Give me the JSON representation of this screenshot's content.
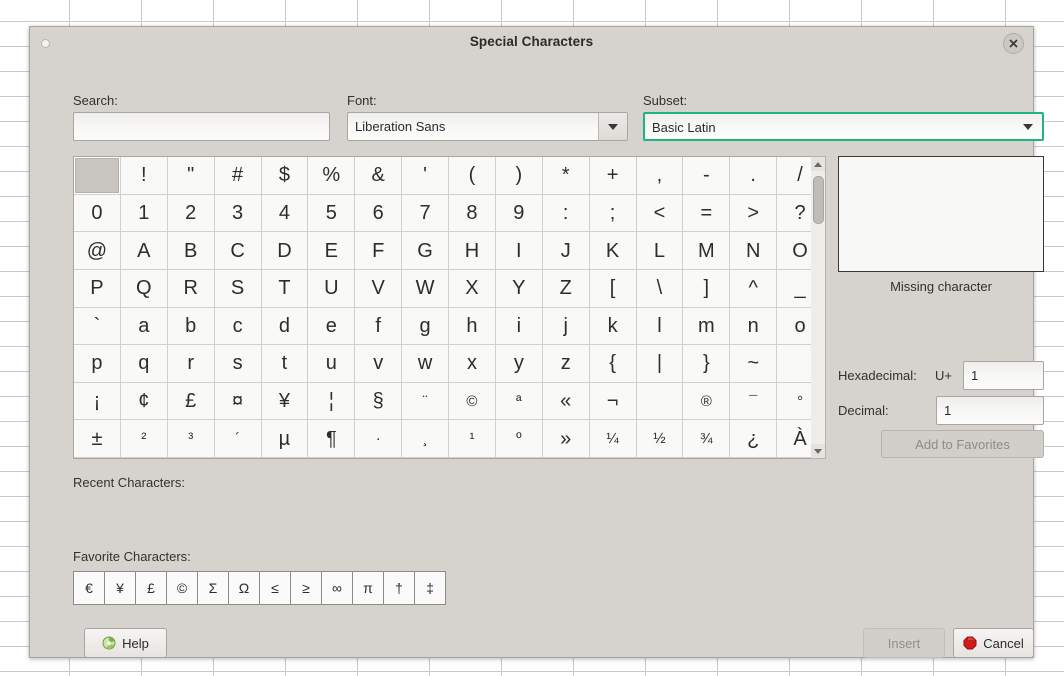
{
  "dialog": {
    "title": "Special Characters",
    "close_icon": "close-icon"
  },
  "form": {
    "search_label": "Search:",
    "search_value": "",
    "search_placeholder": "",
    "font_label": "Font:",
    "font_value": "Liberation Sans",
    "subset_label": "Subset:",
    "subset_value": "Basic Latin",
    "subset_focus_color": "#21b47c"
  },
  "grid": {
    "selected_index": 0,
    "rows": [
      [
        " ",
        "!",
        "\"",
        "#",
        "$",
        "%",
        "&",
        "'",
        "(",
        ")",
        "*",
        "+",
        ",",
        "-",
        ".",
        "/"
      ],
      [
        "0",
        "1",
        "2",
        "3",
        "4",
        "5",
        "6",
        "7",
        "8",
        "9",
        ":",
        ";",
        "<",
        "=",
        ">",
        "?"
      ],
      [
        "@",
        "A",
        "B",
        "C",
        "D",
        "E",
        "F",
        "G",
        "H",
        "I",
        "J",
        "K",
        "L",
        "M",
        "N",
        "O"
      ],
      [
        "P",
        "Q",
        "R",
        "S",
        "T",
        "U",
        "V",
        "W",
        "X",
        "Y",
        "Z",
        "[",
        "\\",
        "]",
        "^",
        "_"
      ],
      [
        "`",
        "a",
        "b",
        "c",
        "d",
        "e",
        "f",
        "g",
        "h",
        "i",
        "j",
        "k",
        "l",
        "m",
        "n",
        "o"
      ],
      [
        "p",
        "q",
        "r",
        "s",
        "t",
        "u",
        "v",
        "w",
        "x",
        "y",
        "z",
        "{",
        "|",
        "}",
        "~",
        ""
      ],
      [
        "¡",
        "¢",
        "£",
        "¤",
        "¥",
        "¦",
        "§",
        "¨",
        "©",
        "ª",
        "«",
        "¬",
        "",
        "®",
        "¯",
        "°"
      ],
      [
        "±",
        "²",
        "³",
        "´",
        "µ",
        "¶",
        "·",
        "¸",
        "¹",
        "º",
        "»",
        "¼",
        "½",
        "¾",
        "¿",
        "À"
      ]
    ]
  },
  "preview": {
    "character": "",
    "missing_label": "Missing character",
    "hexadecimal_label": "Hexadecimal:",
    "uplus_label": "U+",
    "hexadecimal_value": "1",
    "decimal_label": "Decimal:",
    "decimal_value": "1",
    "add_to_favorites_label": "Add to Favorites"
  },
  "recent": {
    "label": "Recent Characters:",
    "items": []
  },
  "favorites": {
    "label": "Favorite Characters:",
    "items": [
      "€",
      "¥",
      "£",
      "©",
      "Σ",
      "Ω",
      "≤",
      "≥",
      "∞",
      "π",
      "†",
      "‡"
    ]
  },
  "footer": {
    "help_label": "Help",
    "insert_label": "Insert",
    "cancel_label": "Cancel"
  }
}
